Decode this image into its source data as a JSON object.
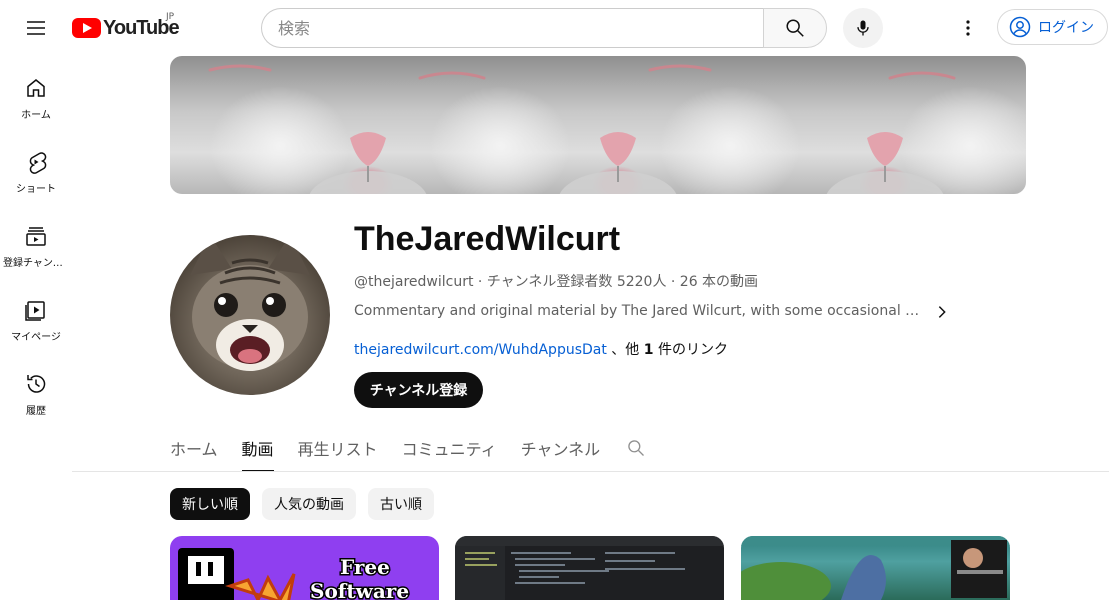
{
  "header": {
    "logo_text": "YouTube",
    "logo_region": "JP",
    "search_placeholder": "検索",
    "signin_label": "ログイン"
  },
  "sidebar": {
    "items": [
      {
        "label": "ホーム",
        "icon": "home-icon"
      },
      {
        "label": "ショート",
        "icon": "shorts-icon"
      },
      {
        "label": "登録チャンネル",
        "icon": "subscriptions-icon"
      },
      {
        "label": "マイページ",
        "icon": "you-icon"
      },
      {
        "label": "履歴",
        "icon": "history-icon"
      }
    ]
  },
  "channel": {
    "name": "TheJaredWilcurt",
    "meta": "@thejaredwilcurt · チャンネル登録者数 5220人 · 26 本の動画",
    "description": "Commentary and original material by The Jared Wilcurt, with some occasional public domain content.",
    "link_url": "thejaredwilcurt.com/WuhdAppusDat",
    "link_suffix_pre": " 、他 ",
    "link_count": "1",
    "link_suffix_post": " 件のリンク",
    "subscribe_label": "チャンネル登録"
  },
  "tabs": [
    {
      "label": "ホーム",
      "active": false
    },
    {
      "label": "動画",
      "active": true
    },
    {
      "label": "再生リスト",
      "active": false
    },
    {
      "label": "コミュニティ",
      "active": false
    },
    {
      "label": "チャンネル",
      "active": false
    }
  ],
  "chips": [
    {
      "label": "新しい順",
      "selected": true
    },
    {
      "label": "人気の動画",
      "selected": false
    },
    {
      "label": "古い順",
      "selected": false
    }
  ],
  "thumbnails": [
    {
      "text_line1": "Free",
      "text_line2": "Software"
    },
    {},
    {}
  ],
  "colors": {
    "brand_red": "#ff0000",
    "link_blue": "#065fd4",
    "primary_text": "#0f0f0f",
    "secondary_text": "#606060"
  }
}
